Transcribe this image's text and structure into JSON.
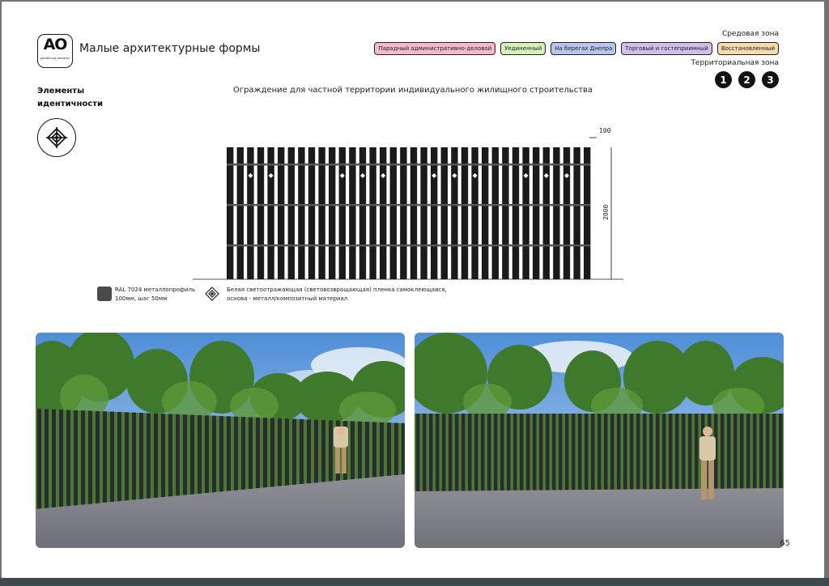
{
  "header": {
    "logo_mark": "АО",
    "logo_small_text": "дизайн-код смоленск",
    "title": "Малые архитектурные формы"
  },
  "identity": {
    "label": "Элементы идентичности",
    "icon": "ornament-diamond-icon"
  },
  "zones": {
    "environment_label": "Средовая зона",
    "badges": [
      {
        "label": "Парадный административно-деловой",
        "color": "#f7b8cf"
      },
      {
        "label": "Уединенный",
        "color": "#d6f2b9"
      },
      {
        "label": "На берегах Днепра",
        "color": "#b8c6ee"
      },
      {
        "label": "Торговый и гостеприимный",
        "color": "#cfc0ea"
      },
      {
        "label": "Восстановленный",
        "color": "#f6d9ad"
      }
    ],
    "territory_label": "Территориальная зона",
    "numbers": [
      "1",
      "2",
      "3"
    ]
  },
  "section": {
    "title": "Ограждение для частной территории индивидуального жилищного строительства"
  },
  "drawing": {
    "dim_width": "100",
    "dim_height": "2000",
    "fence_color": "#1a1a1a"
  },
  "legend": {
    "material_swatch_color": "#4a4a4a",
    "material_line1": "RAL 7024 металлопрофиль",
    "material_line2": "100мм, шаг 50мм",
    "film_icon": "ornament-diamond-icon",
    "film_line1": "Белая светоотражающая (световозвращающая) пленка самоклеющаяся,",
    "film_line2": "основа - металл/композитный материал"
  },
  "page_number": "65"
}
